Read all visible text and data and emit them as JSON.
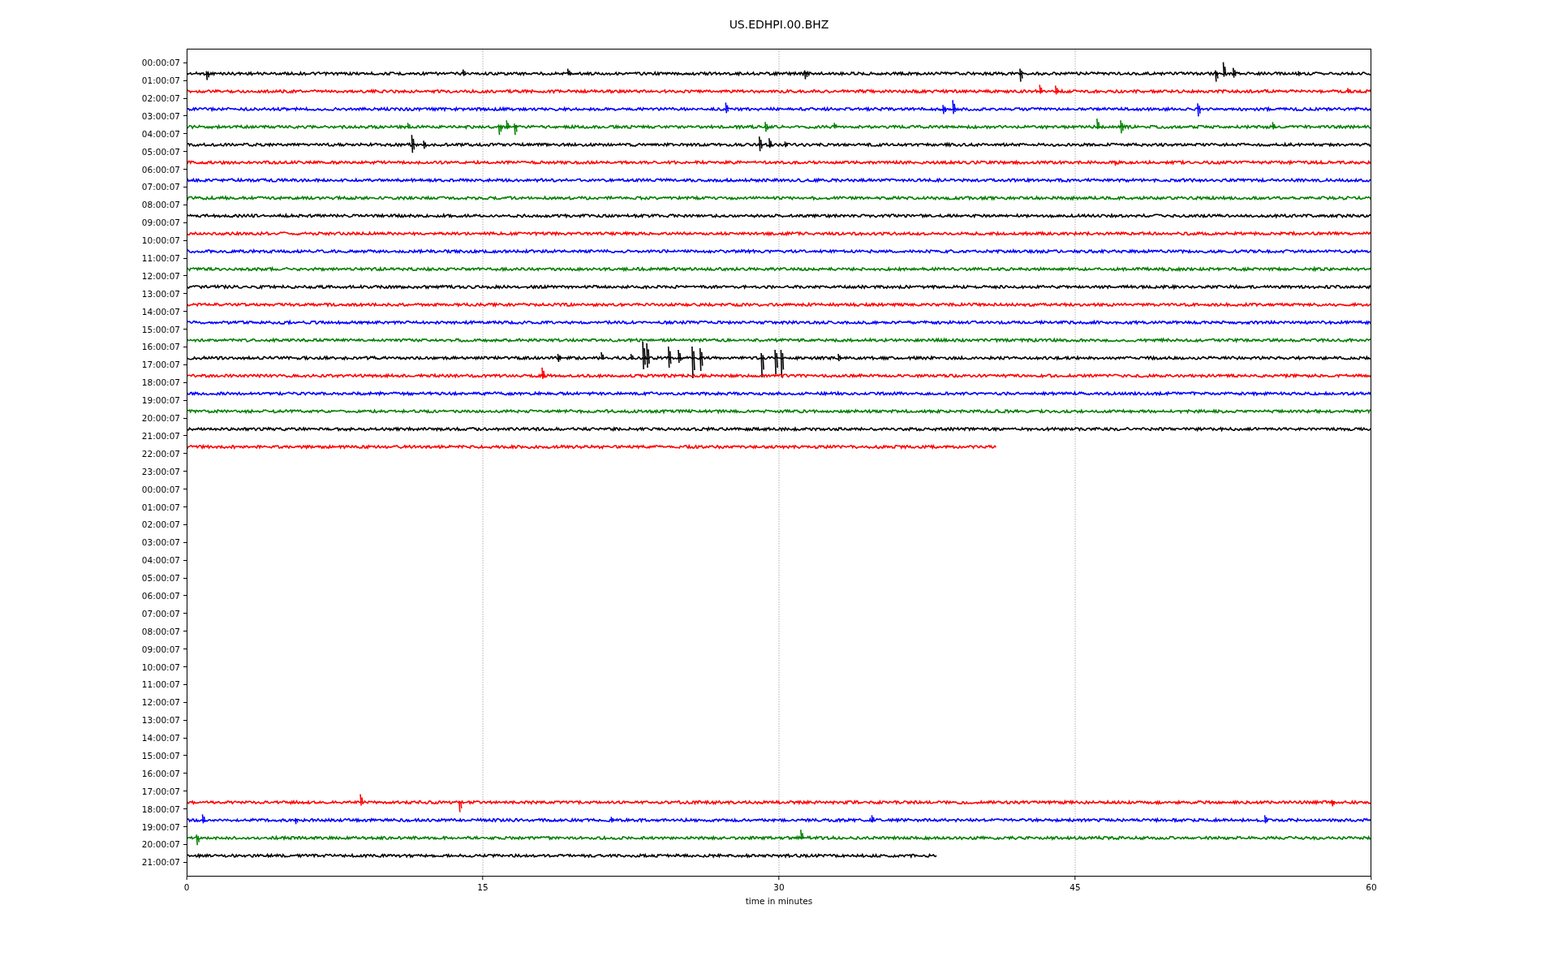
{
  "title": "US.EDHPI.00.BHZ",
  "rows": [
    {
      "label": "00:00:07"
    },
    {
      "label": "01:00:07",
      "trace": {
        "color": "#000000"
      }
    },
    {
      "label": "02:00:07",
      "trace": {
        "color": "#ff0000"
      }
    },
    {
      "label": "03:00:07",
      "trace": {
        "color": "#0000ff"
      }
    },
    {
      "label": "04:00:07",
      "trace": {
        "color": "#008000"
      }
    },
    {
      "label": "05:00:07",
      "trace": {
        "color": "#000000"
      }
    },
    {
      "label": "06:00:07",
      "trace": {
        "color": "#ff0000"
      }
    },
    {
      "label": "07:00:07",
      "trace": {
        "color": "#0000ff"
      }
    },
    {
      "label": "08:00:07",
      "trace": {
        "color": "#008000"
      }
    },
    {
      "label": "09:00:07",
      "trace": {
        "color": "#000000"
      }
    },
    {
      "label": "10:00:07",
      "trace": {
        "color": "#ff0000"
      }
    },
    {
      "label": "11:00:07",
      "trace": {
        "color": "#0000ff"
      }
    },
    {
      "label": "12:00:07",
      "trace": {
        "color": "#008000"
      }
    },
    {
      "label": "13:00:07",
      "trace": {
        "color": "#000000"
      }
    },
    {
      "label": "14:00:07",
      "trace": {
        "color": "#ff0000"
      }
    },
    {
      "label": "15:00:07",
      "trace": {
        "color": "#0000ff"
      }
    },
    {
      "label": "16:00:07",
      "trace": {
        "color": "#008000"
      }
    },
    {
      "label": "17:00:07",
      "trace": {
        "color": "#000000"
      }
    },
    {
      "label": "18:00:07",
      "trace": {
        "color": "#ff0000"
      }
    },
    {
      "label": "19:00:07",
      "trace": {
        "color": "#0000ff"
      }
    },
    {
      "label": "20:00:07",
      "trace": {
        "color": "#008000"
      }
    },
    {
      "label": "21:00:07",
      "trace": {
        "color": "#000000"
      }
    },
    {
      "label": "22:00:07",
      "trace": {
        "color": "#ff0000"
      }
    },
    {
      "label": "23:00:07"
    },
    {
      "label": "00:00:07"
    },
    {
      "label": "01:00:07"
    },
    {
      "label": "02:00:07"
    },
    {
      "label": "03:00:07"
    },
    {
      "label": "04:00:07"
    },
    {
      "label": "05:00:07"
    },
    {
      "label": "06:00:07"
    },
    {
      "label": "07:00:07"
    },
    {
      "label": "08:00:07"
    },
    {
      "label": "09:00:07"
    },
    {
      "label": "10:00:07"
    },
    {
      "label": "11:00:07"
    },
    {
      "label": "12:00:07"
    },
    {
      "label": "13:00:07"
    },
    {
      "label": "14:00:07"
    },
    {
      "label": "15:00:07"
    },
    {
      "label": "16:00:07"
    },
    {
      "label": "17:00:07"
    },
    {
      "label": "18:00:07",
      "trace": {
        "color": "#ff0000"
      }
    },
    {
      "label": "19:00:07",
      "trace": {
        "color": "#0000ff"
      }
    },
    {
      "label": "20:00:07",
      "trace": {
        "color": "#008000"
      }
    },
    {
      "label": "21:00:07",
      "trace": {
        "color": "#000000"
      }
    }
  ],
  "x_ticks": [
    "0",
    "15",
    "30",
    "45",
    "60"
  ],
  "xlabel": "time in minutes"
}
